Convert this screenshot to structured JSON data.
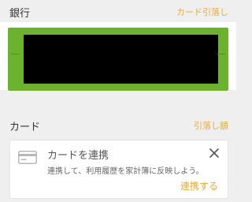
{
  "bank_section": {
    "title": "銀行",
    "action_label": "カード引落し"
  },
  "card_section": {
    "title": "カード",
    "action_label": "引落し額"
  },
  "connect_card": {
    "title": "カードを連携",
    "description": "連携して、利用履歴を家計簿に反映しよう。",
    "link_label": "連携する",
    "icon": "credit-card-icon",
    "close_icon": "close-icon"
  },
  "colors": {
    "accent": "#f0a830",
    "bank_frame": "#6bb22e",
    "background": "#efefef"
  }
}
